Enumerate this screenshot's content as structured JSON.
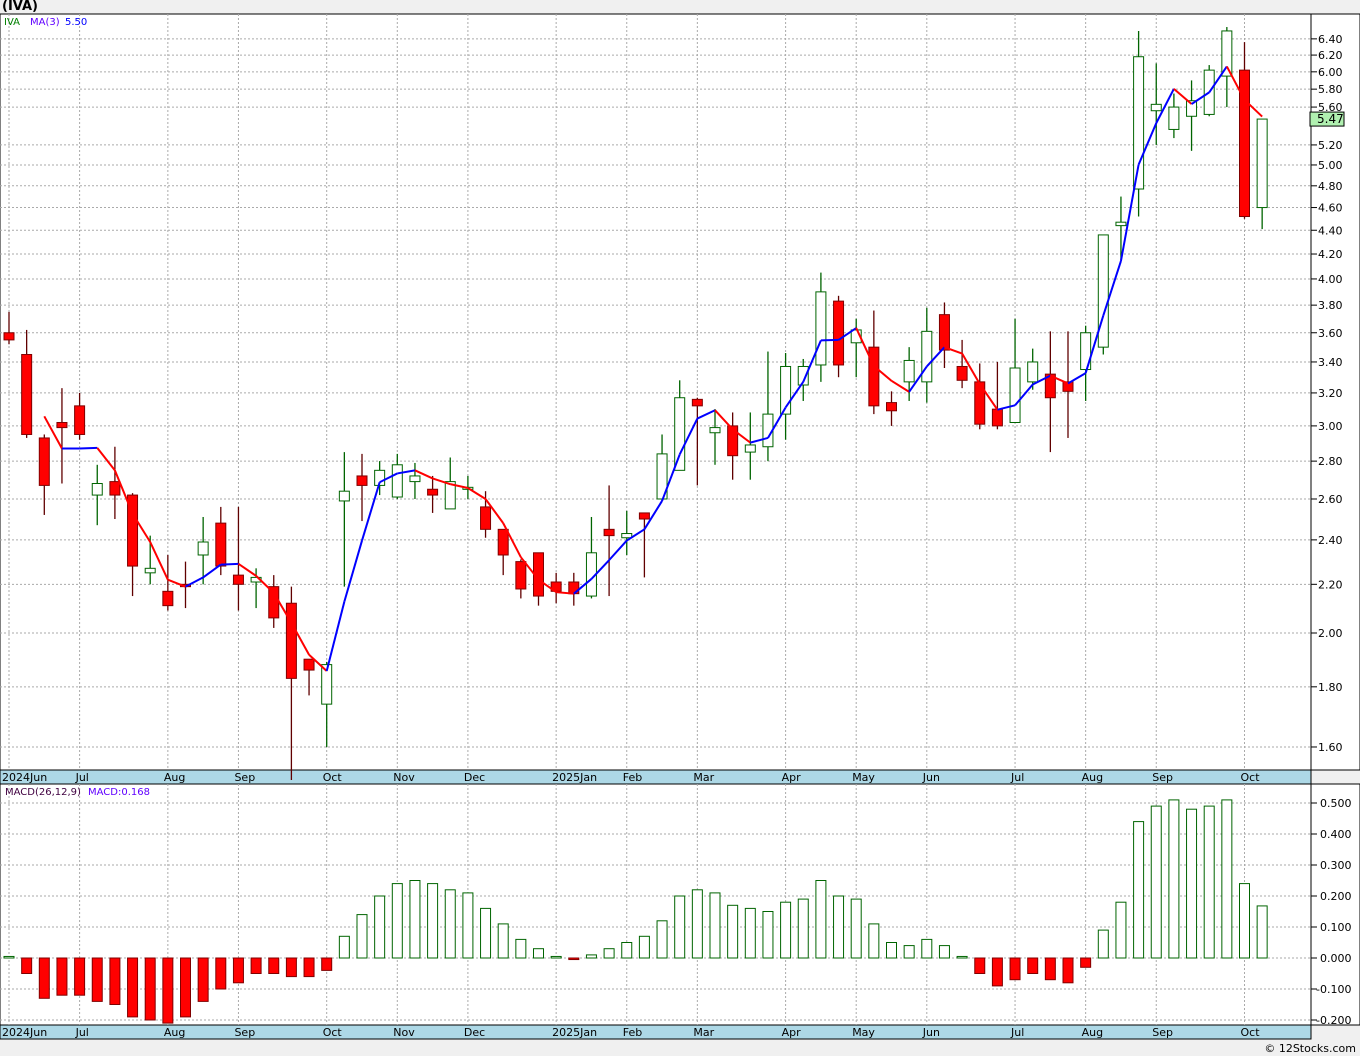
{
  "title": "(IVA)",
  "footer": "© 12Stocks.com",
  "legend": {
    "symbol": "IVA",
    "ma_label": "MA(3)",
    "ma_value": "5.50",
    "macd_label": "MACD(26,12,9)",
    "macd_value": "MACD:0.168"
  },
  "colors": {
    "up": "#006400",
    "down": "#ff0000",
    "ma_up": "#0000ff",
    "ma_down": "#ff0000",
    "date_band": "#add8e6",
    "last_badge": "#b0f0b0"
  },
  "chart_data": [
    {
      "type": "candlestick",
      "scale": "log",
      "ylim": [
        1.5,
        6.6
      ],
      "grid": true,
      "yticks": [
        "1.60",
        "1.80",
        "2.00",
        "2.20",
        "2.40",
        "2.60",
        "2.80",
        "3.00",
        "3.20",
        "3.40",
        "3.60",
        "3.80",
        "4.00",
        "4.20",
        "4.40",
        "4.60",
        "4.80",
        "5.00",
        "5.20",
        "5.60",
        "5.80",
        "6.00",
        "6.20",
        "6.40"
      ],
      "last_price": "5.47",
      "ma_period": 3,
      "xticks": [
        {
          "week": 0,
          "label": "2024Jun"
        },
        {
          "week": 4,
          "label": "Jul"
        },
        {
          "week": 9,
          "label": "Aug"
        },
        {
          "week": 13,
          "label": "Sep"
        },
        {
          "week": 18,
          "label": "Oct"
        },
        {
          "week": 22,
          "label": "Nov"
        },
        {
          "week": 26,
          "label": "Dec"
        },
        {
          "week": 31,
          "label": "2025Jan"
        },
        {
          "week": 35,
          "label": "Feb"
        },
        {
          "week": 39,
          "label": "Mar"
        },
        {
          "week": 44,
          "label": "Apr"
        },
        {
          "week": 48,
          "label": "May"
        },
        {
          "week": 52,
          "label": "Jun"
        },
        {
          "week": 57,
          "label": "Jul"
        },
        {
          "week": 61,
          "label": "Aug"
        },
        {
          "week": 65,
          "label": "Sep"
        },
        {
          "week": 70,
          "label": "Oct"
        }
      ],
      "ohlc": [
        [
          3.6,
          3.75,
          3.52,
          3.55
        ],
        [
          3.45,
          3.62,
          2.93,
          2.95
        ],
        [
          2.93,
          2.95,
          2.52,
          2.67
        ],
        [
          3.02,
          3.23,
          2.68,
          2.99
        ],
        [
          3.12,
          3.2,
          2.92,
          2.95
        ],
        [
          2.62,
          2.78,
          2.47,
          2.68
        ],
        [
          2.69,
          2.88,
          2.5,
          2.62
        ],
        [
          2.62,
          2.63,
          2.15,
          2.28
        ],
        [
          2.25,
          2.42,
          2.2,
          2.27
        ],
        [
          2.17,
          2.33,
          2.09,
          2.11
        ],
        [
          2.2,
          2.3,
          2.1,
          2.19
        ],
        [
          2.33,
          2.51,
          2.2,
          2.39
        ],
        [
          2.48,
          2.56,
          2.24,
          2.28
        ],
        [
          2.24,
          2.56,
          2.09,
          2.2
        ],
        [
          2.21,
          2.27,
          2.1,
          2.23
        ],
        [
          2.19,
          2.24,
          2.02,
          2.06
        ],
        [
          2.12,
          2.19,
          1.5,
          1.83
        ],
        [
          1.9,
          1.9,
          1.77,
          1.86
        ],
        [
          1.74,
          1.89,
          1.6,
          1.88
        ],
        [
          2.59,
          2.85,
          2.19,
          2.64
        ],
        [
          2.72,
          2.84,
          2.49,
          2.67
        ],
        [
          2.67,
          2.8,
          2.62,
          2.75
        ],
        [
          2.61,
          2.84,
          2.6,
          2.78
        ],
        [
          2.69,
          2.79,
          2.6,
          2.72
        ],
        [
          2.65,
          2.72,
          2.53,
          2.62
        ],
        [
          2.55,
          2.82,
          2.55,
          2.69
        ],
        [
          2.66,
          2.72,
          2.6,
          2.66
        ],
        [
          2.56,
          2.64,
          2.41,
          2.45
        ],
        [
          2.45,
          2.45,
          2.24,
          2.33
        ],
        [
          2.3,
          2.31,
          2.14,
          2.18
        ],
        [
          2.34,
          2.34,
          2.11,
          2.15
        ],
        [
          2.21,
          2.25,
          2.12,
          2.17
        ],
        [
          2.21,
          2.25,
          2.11,
          2.16
        ],
        [
          2.15,
          2.51,
          2.14,
          2.34
        ],
        [
          2.45,
          2.67,
          2.15,
          2.42
        ],
        [
          2.41,
          2.54,
          2.33,
          2.43
        ],
        [
          2.53,
          2.53,
          2.23,
          2.5
        ],
        [
          2.6,
          2.95,
          2.59,
          2.84
        ],
        [
          2.75,
          3.28,
          2.75,
          3.17
        ],
        [
          3.16,
          3.17,
          2.67,
          3.12
        ],
        [
          2.96,
          3.1,
          2.78,
          2.99
        ],
        [
          3.0,
          3.08,
          2.7,
          2.83
        ],
        [
          2.85,
          3.08,
          2.7,
          2.89
        ],
        [
          2.88,
          3.47,
          2.8,
          3.07
        ],
        [
          3.07,
          3.46,
          2.92,
          3.37
        ],
        [
          3.25,
          3.42,
          3.15,
          3.37
        ],
        [
          3.38,
          4.05,
          3.27,
          3.9
        ],
        [
          3.83,
          3.87,
          3.3,
          3.38
        ],
        [
          3.53,
          3.7,
          3.3,
          3.62
        ],
        [
          3.5,
          3.76,
          3.07,
          3.12
        ],
        [
          3.14,
          3.21,
          3.0,
          3.09
        ],
        [
          3.27,
          3.5,
          3.15,
          3.41
        ],
        [
          3.27,
          3.78,
          3.14,
          3.61
        ],
        [
          3.73,
          3.82,
          3.36,
          3.48
        ],
        [
          3.37,
          3.55,
          3.23,
          3.28
        ],
        [
          3.27,
          3.39,
          2.98,
          3.01
        ],
        [
          3.1,
          3.4,
          2.98,
          3.0
        ],
        [
          3.02,
          3.7,
          3.02,
          3.36
        ],
        [
          3.27,
          3.49,
          3.22,
          3.4
        ],
        [
          3.32,
          3.61,
          2.85,
          3.17
        ],
        [
          3.27,
          3.61,
          2.93,
          3.21
        ],
        [
          3.35,
          3.65,
          3.15,
          3.6
        ],
        [
          3.5,
          4.36,
          3.45,
          4.36
        ],
        [
          4.44,
          4.7,
          4.15,
          4.47
        ],
        [
          4.77,
          6.5,
          4.52,
          6.18
        ],
        [
          5.56,
          6.1,
          5.2,
          5.63
        ],
        [
          5.36,
          5.75,
          5.27,
          5.6
        ],
        [
          5.5,
          5.9,
          5.14,
          5.67
        ],
        [
          5.52,
          6.08,
          5.5,
          6.02
        ],
        [
          5.95,
          6.55,
          5.6,
          6.5
        ],
        [
          6.02,
          6.36,
          4.5,
          4.52
        ],
        [
          4.6,
          5.47,
          4.41,
          5.47
        ]
      ]
    },
    {
      "type": "bar",
      "name": "MACD(26,12,9)",
      "ylim": [
        -0.22,
        0.55
      ],
      "grid": true,
      "yticks": [
        "0.500",
        "0.400",
        "0.300",
        "0.200",
        "0.100",
        "0.000",
        "-0.100",
        "-0.200"
      ],
      "values": [
        0.005,
        -0.05,
        -0.13,
        -0.12,
        -0.12,
        -0.14,
        -0.15,
        -0.19,
        -0.2,
        -0.21,
        -0.19,
        -0.14,
        -0.1,
        -0.08,
        -0.05,
        -0.05,
        -0.06,
        -0.06,
        -0.04,
        0.07,
        0.14,
        0.2,
        0.24,
        0.25,
        0.24,
        0.22,
        0.21,
        0.16,
        0.11,
        0.06,
        0.03,
        0.005,
        -0.005,
        0.01,
        0.03,
        0.05,
        0.07,
        0.12,
        0.2,
        0.22,
        0.21,
        0.17,
        0.16,
        0.15,
        0.18,
        0.19,
        0.25,
        0.2,
        0.19,
        0.11,
        0.05,
        0.04,
        0.06,
        0.04,
        0.005,
        -0.05,
        -0.09,
        -0.07,
        -0.05,
        -0.07,
        -0.08,
        -0.03,
        0.09,
        0.18,
        0.44,
        0.49,
        0.51,
        0.48,
        0.49,
        0.51,
        0.24,
        0.168
      ]
    }
  ]
}
